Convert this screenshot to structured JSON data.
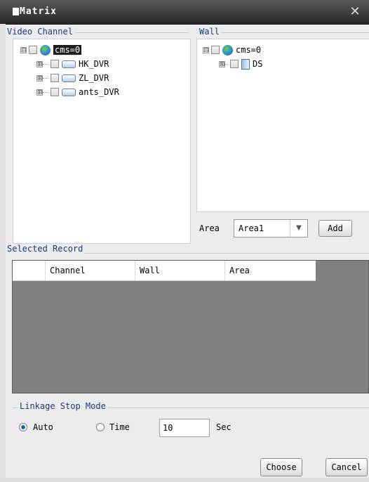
{
  "window": {
    "title": "Matrix",
    "close_symbol": "✕"
  },
  "video_channel": {
    "label": "Video Channel",
    "root": {
      "expander": "⊟",
      "label": "cms=0",
      "selected": true
    },
    "children": [
      {
        "expander": "⊞",
        "label": "HK_DVR"
      },
      {
        "expander": "⊞",
        "label": "ZL_DVR"
      },
      {
        "expander": "⊞",
        "label": "ants_DVR"
      }
    ]
  },
  "wall": {
    "label": "Wall",
    "root": {
      "expander": "⊟",
      "label": "cms=0"
    },
    "children": [
      {
        "expander": "⊞",
        "label": "DS"
      }
    ]
  },
  "area": {
    "label": "Area",
    "value": "Area1",
    "arrow": "▼"
  },
  "add_button": "Add",
  "selected_record": {
    "label": "Selected Record",
    "columns": [
      "Channel",
      "Wall",
      "Area"
    ]
  },
  "linkage": {
    "label": "Linkage Stop Mode",
    "options": [
      {
        "label": "Auto",
        "selected": true
      },
      {
        "label": "Time",
        "selected": false
      }
    ],
    "time_value": "10",
    "unit": "Sec"
  },
  "buttons": {
    "choose": "Choose",
    "cancel": "Cancel"
  },
  "colors": {
    "title_bar": "#3a3a3a",
    "grid_background": "#808080",
    "selection": "#1d1d1d",
    "group_label": "#1a3a7a"
  },
  "icons": [
    "globe-icon",
    "dvr-device-icon",
    "display-screen-icon",
    "close-icon",
    "dropdown-arrow-icon"
  ]
}
